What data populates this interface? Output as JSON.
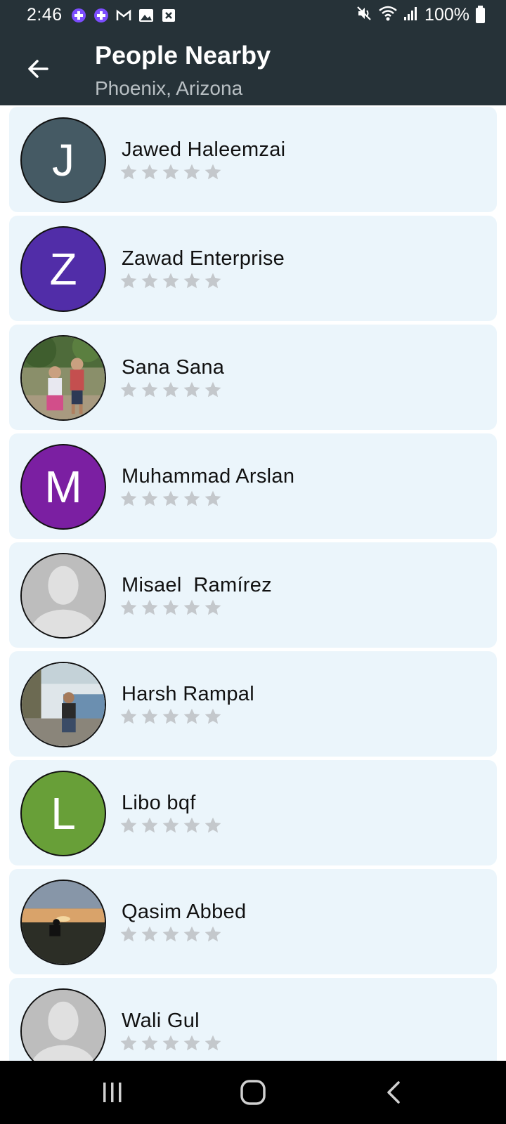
{
  "status_bar": {
    "time": "2:46",
    "battery": "100%",
    "left_icons": [
      "app-notification-icon",
      "app-notification-icon",
      "gmail-icon",
      "gallery-icon",
      "close-box-icon"
    ],
    "right_icons": [
      "mute-icon",
      "wifi-icon",
      "signal-icon",
      "battery-icon"
    ]
  },
  "header": {
    "title": "People Nearby",
    "subtitle": "Phoenix, Arizona"
  },
  "colors": {
    "app_bar": "#263238",
    "card_bg": "#ebf5fb",
    "star_empty": "#c4c8cc"
  },
  "people": [
    {
      "name": "Jawed Haleemzai",
      "initial": "J",
      "avatar_color": "#455a64",
      "avatar_type": "initial",
      "rating": 0
    },
    {
      "name": "Zawad Enterprise",
      "initial": "Z",
      "avatar_color": "#512da8",
      "avatar_type": "initial",
      "rating": 0
    },
    {
      "name": "Sana Sana",
      "avatar_type": "photo-children",
      "rating": 0
    },
    {
      "name": "Muhammad Arslan",
      "initial": "M",
      "avatar_color": "#7b1fa2",
      "avatar_type": "initial",
      "rating": 0
    },
    {
      "name": "Misael  Ramírez",
      "avatar_type": "placeholder",
      "rating": 0
    },
    {
      "name": "Harsh Rampal",
      "avatar_type": "photo-lake",
      "rating": 0
    },
    {
      "name": "Libo bqf",
      "initial": "L",
      "avatar_color": "#689f38",
      "avatar_type": "initial",
      "rating": 0
    },
    {
      "name": "Qasim Abbed",
      "avatar_type": "photo-sunset",
      "rating": 0
    },
    {
      "name": "Wali Gul",
      "avatar_type": "placeholder",
      "rating": 0
    }
  ],
  "nav_bar": {
    "buttons": [
      "recents-icon",
      "home-icon",
      "back-nav-icon"
    ]
  }
}
